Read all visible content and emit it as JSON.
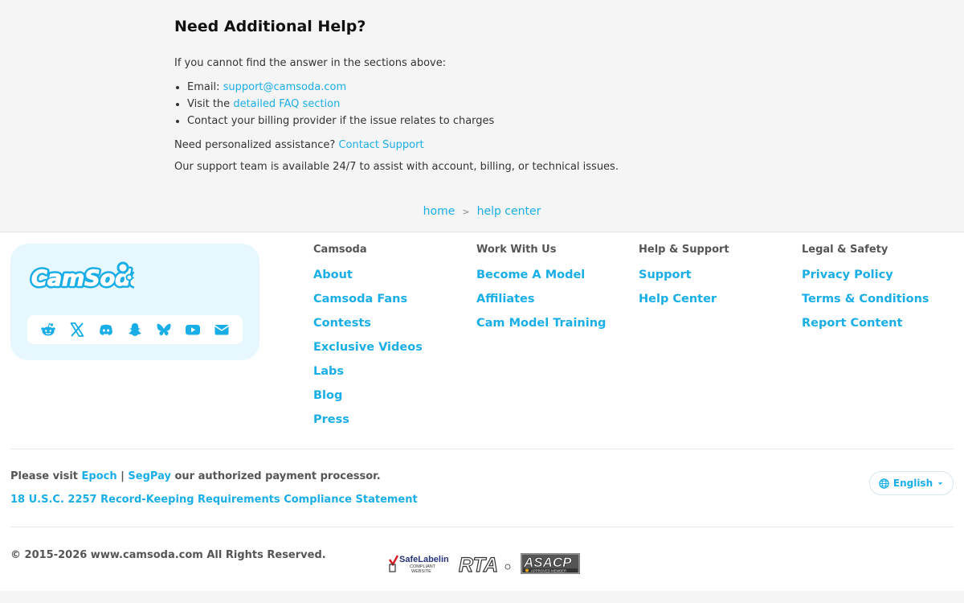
{
  "help": {
    "title": "Need Additional Help?",
    "intro": "If you cannot find the answer in the sections above:",
    "email_label": "Email: ",
    "email_link": "support@camsoda.com",
    "visit_label": "Visit the ",
    "faq_link": "detailed FAQ section",
    "billing_text": "Contact your billing provider if the issue relates to charges",
    "personal_label": "Need personalized assistance? ",
    "contact_link": "Contact Support",
    "team_text": "Our support team is available 24/7 to assist with account, billing, or technical issues."
  },
  "breadcrumb": {
    "home": "home",
    "sep": ">",
    "current": "help center"
  },
  "brand": {
    "logo_text": "CamSoda",
    "social_icons": [
      "reddit-icon",
      "x-icon",
      "discord-icon",
      "snapchat-icon",
      "bluesky-icon",
      "youtube-icon",
      "email-icon"
    ]
  },
  "footer": {
    "columns": [
      {
        "heading": "Camsoda",
        "links": [
          "About",
          "Camsoda Fans",
          "Contests",
          "Exclusive Videos",
          "Labs",
          "Blog",
          "Press"
        ]
      },
      {
        "heading": "Work With Us",
        "links": [
          "Become A Model",
          "Affiliates",
          "Cam Model Training"
        ]
      },
      {
        "heading": "Help & Support",
        "links": [
          "Support",
          "Help Center"
        ]
      },
      {
        "heading": "Legal & Safety",
        "links": [
          "Privacy Policy",
          "Terms & Conditions",
          "Report Content"
        ]
      }
    ],
    "payment_prefix": "Please visit ",
    "epoch": "Epoch",
    "pipe": " | ",
    "segpay": "SegPay",
    "payment_suffix": " our authorized payment processor.",
    "record_keeping": "18 U.S.C. 2257 Record-Keeping Requirements Compliance Statement",
    "language": "English",
    "copyright": "© 2015-2026 www.camsoda.com All Rights Reserved.",
    "badges": {
      "safelabeling": "SafeLabeling",
      "safelabeling_sub1": "COMPLIANT",
      "safelabeling_sub2": "WEBSITE",
      "rta": "RTA",
      "asacp": "ASACP",
      "asacp_sub": "APPROVED MEMBER"
    }
  },
  "colors": {
    "accent": "#1aaee6",
    "page_bg": "#f5f5f5",
    "brand_box": "#e6f7fe"
  }
}
